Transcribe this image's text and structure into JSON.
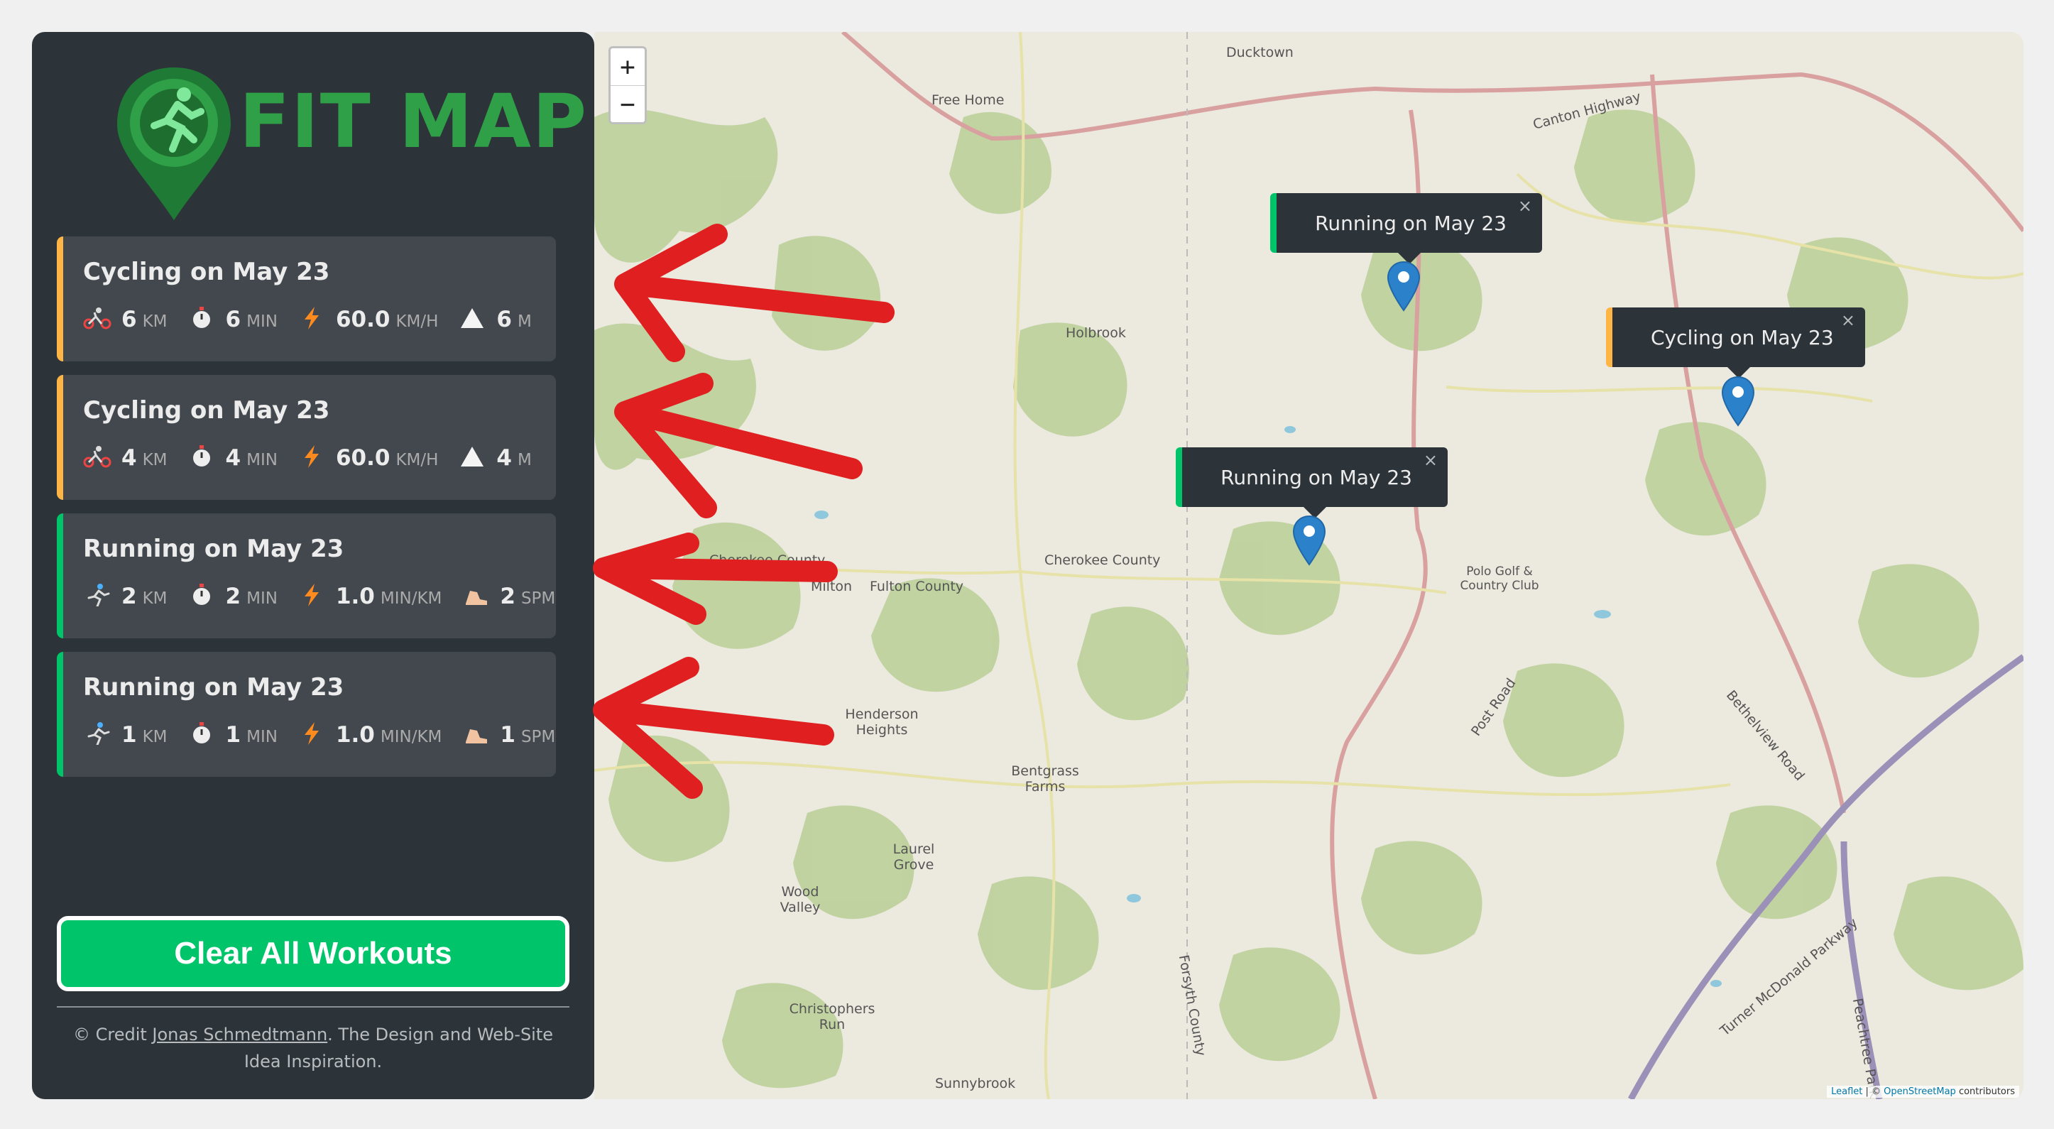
{
  "brand": {
    "name": "FIT MAP"
  },
  "workouts": [
    {
      "type": "cycling",
      "title": "Cycling on May 23",
      "distance": "6",
      "distance_unit": "KM",
      "duration": "6",
      "duration_unit": "MIN",
      "speed": "60.0",
      "speed_unit": "KM/H",
      "extra": "6",
      "extra_unit": "M",
      "extra_icon": "elevation-icon"
    },
    {
      "type": "cycling",
      "title": "Cycling on May 23",
      "distance": "4",
      "distance_unit": "KM",
      "duration": "4",
      "duration_unit": "MIN",
      "speed": "60.0",
      "speed_unit": "KM/H",
      "extra": "4",
      "extra_unit": "M",
      "extra_icon": "elevation-icon"
    },
    {
      "type": "running",
      "title": "Running on May 23",
      "distance": "2",
      "distance_unit": "KM",
      "duration": "2",
      "duration_unit": "MIN",
      "speed": "1.0",
      "speed_unit": "MIN/KM",
      "extra": "2",
      "extra_unit": "SPM",
      "extra_icon": "footprint-icon"
    },
    {
      "type": "running",
      "title": "Running on May 23",
      "distance": "1",
      "distance_unit": "KM",
      "duration": "1",
      "duration_unit": "MIN",
      "speed": "1.0",
      "speed_unit": "MIN/KM",
      "extra": "1",
      "extra_unit": "SPM",
      "extra_icon": "footprint-icon"
    }
  ],
  "clear_button": {
    "label": "Clear All Workouts"
  },
  "credit": {
    "prefix": "© Credit ",
    "author": "Jonas Schmedtmann",
    "suffix": ". The Design and Web-Site Idea Inspiration."
  },
  "map": {
    "zoom_in": "+",
    "zoom_out": "−",
    "popups": [
      {
        "type": "running",
        "label": "Running on May 23",
        "close": "×"
      },
      {
        "type": "cycling",
        "label": "Cycling on May 23",
        "close": "×"
      },
      {
        "type": "running",
        "label": "Running on May 23",
        "close": "×"
      }
    ],
    "attribution": {
      "leaflet": "Leaflet",
      "sep": " | © ",
      "osm": "OpenStreetMap",
      "suffix": " contributors"
    },
    "place_labels": [
      "Ducktown",
      "Free Home",
      "Canton Highway",
      "Holbrook",
      "Cherokee County",
      "Fulton County",
      "Cherokee County",
      "Milton",
      "Post Road",
      "Polo Golf & Country Club",
      "Bethelview Road",
      "Henderson Heights",
      "Bentgrass Farms",
      "Laurel Grove",
      "Wood Valley",
      "Christophers Run",
      "Sunnybrook",
      "Turner McDonald Parkway",
      "Peachtree Park",
      "Forsyth County"
    ]
  },
  "colors": {
    "cycling": "#ffb545",
    "running": "#00c46a",
    "sidebar": "#2d3439",
    "card": "#42484d",
    "brand_green": "#2fa047",
    "annotation_arrow": "#e02020"
  }
}
